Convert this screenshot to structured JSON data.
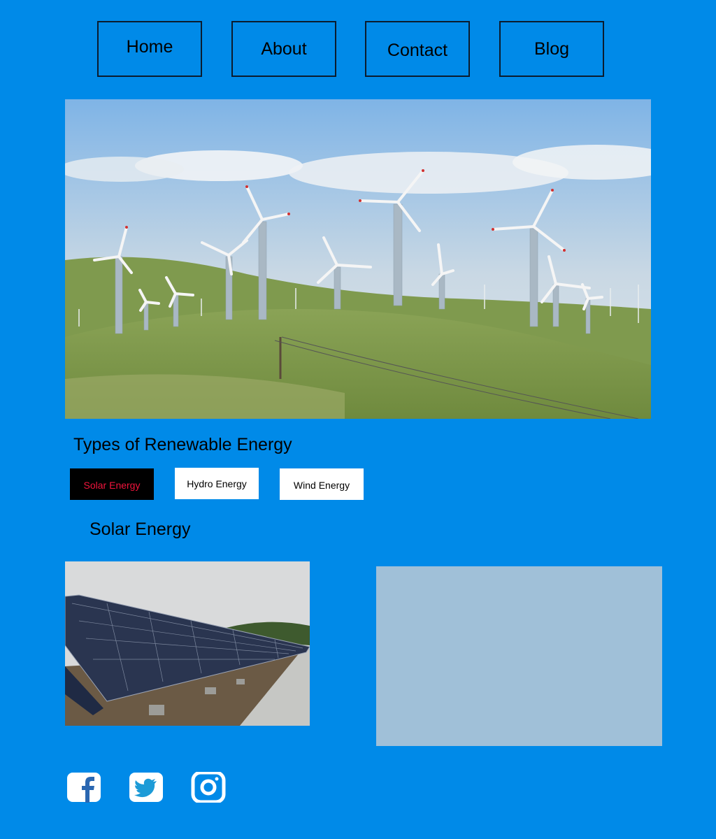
{
  "nav": {
    "home": "Home",
    "about": "About",
    "contact": "Contact",
    "blog": "Blog"
  },
  "hero": {
    "image": "wind-farm-photo"
  },
  "section": {
    "title": "Types of Renewable Energy"
  },
  "tabs": [
    {
      "label": "Solar Energy",
      "active": true
    },
    {
      "label": "Hydro Energy",
      "active": false
    },
    {
      "label": "Wind Energy",
      "active": false
    }
  ],
  "content": {
    "title": "Solar Energy",
    "image": "solar-panels-photo"
  },
  "social": [
    "facebook-icon",
    "twitter-icon",
    "instagram-icon"
  ],
  "colors": {
    "background": "#008ae8",
    "active_tab_bg": "#000000",
    "active_tab_text": "#f0143c",
    "panel": "#a0c0d8"
  }
}
